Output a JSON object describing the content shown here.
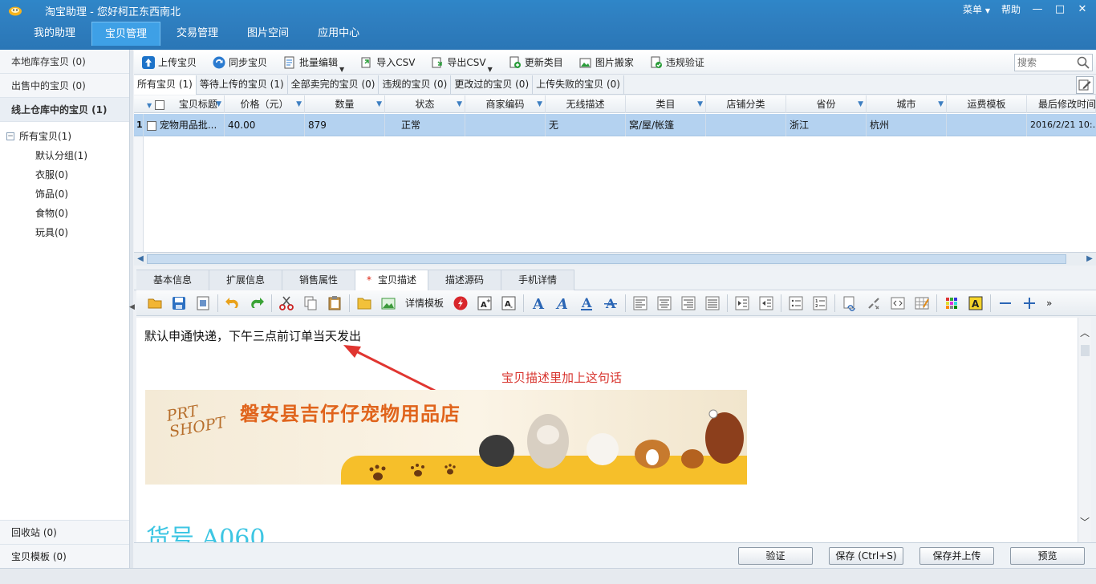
{
  "app": {
    "title": "淘宝助理 - 您好柯正东西南北",
    "menu_label": "菜单",
    "help_label": "帮助",
    "minimize": "—",
    "maximize": "□",
    "close": "✕"
  },
  "nav": {
    "items": [
      {
        "label": "我的助理",
        "active": false
      },
      {
        "label": "宝贝管理",
        "active": true
      },
      {
        "label": "交易管理",
        "active": false
      },
      {
        "label": "图片空间",
        "active": false
      },
      {
        "label": "应用中心",
        "active": false
      }
    ]
  },
  "sidebar": {
    "local": "本地库存宝贝 (0)",
    "selling": "出售中的宝贝 (0)",
    "warehouse": "线上仓库中的宝贝 (1)",
    "tree_toggle": "−",
    "tree_root": "所有宝贝(1)",
    "tree_children": [
      "默认分组(1)",
      "衣服(0)",
      "饰品(0)",
      "食物(0)",
      "玩具(0)"
    ],
    "recycle": "回收站 (0)",
    "templates": "宝贝模板 (0)"
  },
  "toolbar": {
    "upload": "上传宝贝",
    "sync": "同步宝贝",
    "batch_edit": "批量编辑",
    "import_csv": "导入CSV",
    "export_csv": "导出CSV",
    "update_category": "更新类目",
    "image_move": "图片搬家",
    "violation_check": "违规验证",
    "search_placeholder": "搜索"
  },
  "filter_tabs": [
    "所有宝贝 (1)",
    "等待上传的宝贝 (1)",
    "全部卖完的宝贝 (0)",
    "违规的宝贝 (0)",
    "更改过的宝贝 (0)",
    "上传失败的宝贝 (0)"
  ],
  "grid": {
    "headers": [
      "宝贝标题",
      "价格（元）",
      "数量",
      "状态",
      "商家编码",
      "无线描述",
      "类目",
      "店铺分类",
      "省份",
      "城市",
      "运费模板",
      "最后修改时间"
    ],
    "rows": [
      {
        "index": "1",
        "title": "宠物用品批...",
        "price": "40.00",
        "quantity": "879",
        "status": "正常",
        "merchant_code": "",
        "wireless_desc": "无",
        "category": "窝/屋/帐篷",
        "shop_category": "",
        "province": "浙江",
        "city": "杭州",
        "shipping_template": "",
        "modified": "2016/2/21 10:…"
      }
    ]
  },
  "detail_tabs": [
    {
      "label": "基本信息",
      "active": false
    },
    {
      "label": "扩展信息",
      "active": false
    },
    {
      "label": "销售属性",
      "active": false
    },
    {
      "label": "宝贝描述",
      "active": true,
      "modified_mark": "*"
    },
    {
      "label": "描述源码",
      "active": false
    },
    {
      "label": "手机详情",
      "active": false
    }
  ],
  "editor_toolbar": {
    "template_label": "详情模板",
    "more": "»"
  },
  "editor": {
    "description_line": "默认申通快递，下午三点前订单当天发出",
    "annotation": "宝贝描述里加上这句话",
    "banner_logo": "PRT SHOPT",
    "banner_title": "磐安县吉仔仔宠物用品店",
    "sku_line": "货号  A060"
  },
  "actions": {
    "validate": "验证",
    "save": "保存 (Ctrl+S)",
    "save_upload": "保存并上传",
    "preview": "预览"
  },
  "colors": {
    "titlebar": "#2f7fc0",
    "selected_row": "#b4d2f0",
    "annotation": "#d8342e",
    "sku_text": "#3ec6e3"
  }
}
